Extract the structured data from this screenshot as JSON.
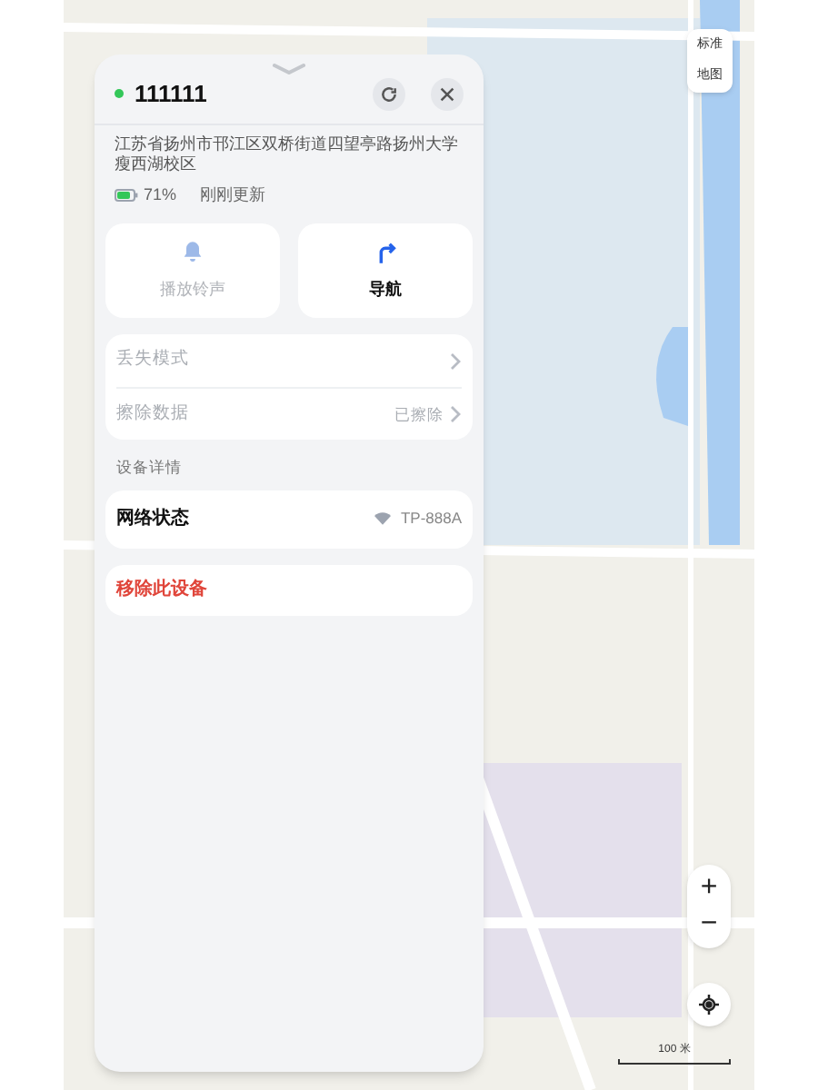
{
  "device": {
    "name": "111111",
    "online": true,
    "address": "江苏省扬州市邗江区双桥街道四望亭路扬州大学瘦西湖校区",
    "battery": "71%",
    "updated": "刚刚更新"
  },
  "actions": [
    {
      "label": "播放铃声",
      "kind": "sound",
      "disabled": true
    },
    {
      "label": "导航",
      "kind": "navigate",
      "disabled": false
    }
  ],
  "security_rows": [
    {
      "label": "丢失模式",
      "disabled": true
    },
    {
      "label": "擦除数据",
      "value": "已擦除",
      "disabled": true
    }
  ],
  "details": {
    "heading": "设备详情",
    "rows": [
      {
        "label": "网络状态",
        "value": "TP-888A"
      }
    ]
  },
  "remove_button": "移除此设备",
  "map_controls": {
    "mode": [
      "标准",
      "地图"
    ],
    "zoom_in": "+",
    "zoom_out": "−",
    "scale": "100 米"
  }
}
